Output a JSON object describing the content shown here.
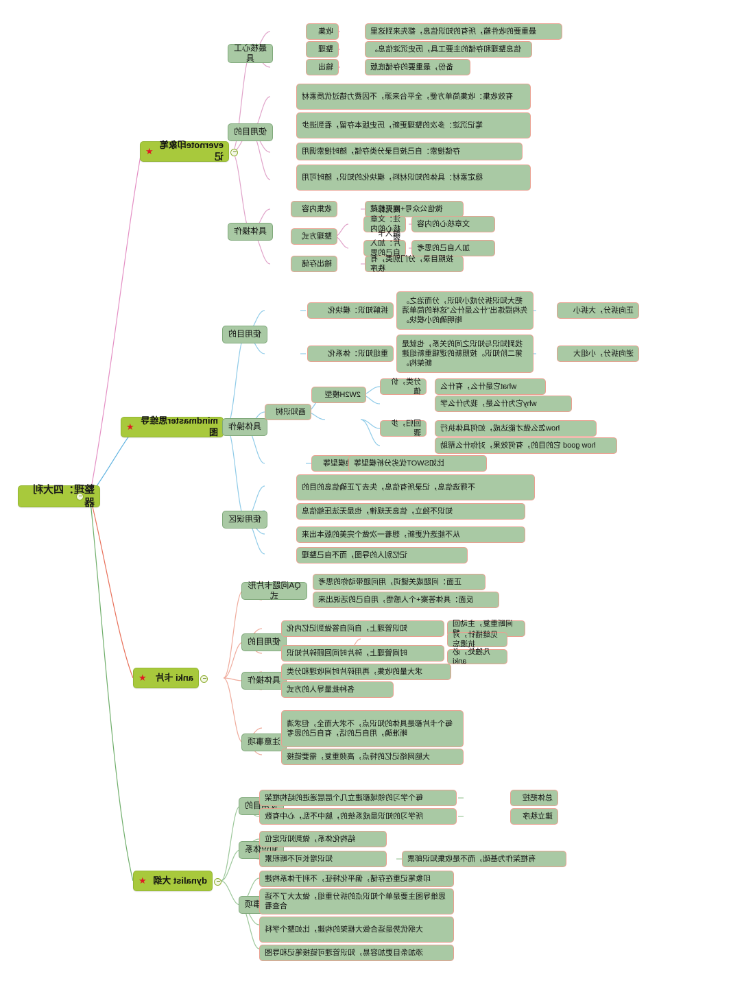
{
  "root": {
    "label": "整理：四大利器"
  },
  "star_glyph": "★",
  "colors": {
    "root_fill": "#a8c93c",
    "branch_fill": "#a8c93c",
    "leaf_fill": "#a9c9a4",
    "leaf_border": "#e9a090",
    "lvl2_border": "#7fa87a",
    "star": "#e01b24",
    "link_evernote": "#e48fc4",
    "link_mindmaster": "#5fb2e0",
    "link_anki": "#e8705a",
    "link_dynalist": "#6fae6a"
  },
  "branches": {
    "evernote": {
      "label": "evernote印象笔记",
      "groups": {
        "core_tool": {
          "label": "最核心工具"
        },
        "purpose": {
          "label": "使用目的"
        },
        "operation": {
          "label": "具体操作"
        }
      },
      "core_tool_items": [
        {
          "label": "收集",
          "desc": "最重要的收件箱，所有的知识信息，都先来到这里"
        },
        {
          "label": "整理",
          "desc": "信息整理和存储的主要工具，历史沉淀信息。"
        },
        {
          "label": "输出",
          "desc": "备份，最重要的存储底版"
        }
      ],
      "purpose_items": [
        "有效收集：收集简单方便，全平台来源，不因费力错过优质素材",
        "笔记沉淀：多次的整理更新，历史版本存留，看到进步",
        "存储搜索：自己按目录分类存储，随时搜索调用",
        "稳定素材：具体的知识材料，模块化的知识，随时可用"
      ],
      "operation_items": [
        {
          "label": "收集内容",
          "desc": "微信公众号+网页剪藏"
        },
        {
          "label": "整理方式",
          "desc": "",
          "children": [
            "高光标注：文章核心的内容",
            "融入卡片：加入自己的思考"
          ]
        },
        {
          "label": "输出存储",
          "desc": "按照目录，分门别类，有秩序"
        }
      ]
    },
    "mindmaster": {
      "label": "mindmaster思维导图",
      "groups": {
        "purpose": {
          "label": "使用目的"
        },
        "operation": {
          "label": "具体操作"
        },
        "pitfalls": {
          "label": "使用误区"
        }
      },
      "purpose_items": [
        {
          "label": "拆解知识：模块化",
          "desc": "把大知识拆分成小知识，分而治之。先构提炼出“什么是什么”这样的简单清晰明确的小模块。",
          "tag": "正向拆分，大拆小"
        },
        {
          "label": "重组知识：体系化",
          "desc": "找到知识与知识之间的关系，也就是第二阶知识。按照新的逻辑重新组建新架构。",
          "tag": "逆向拆分，小组大"
        }
      ],
      "operation_root": "画知识树",
      "model_2w2h": {
        "label": "2W2H模型",
        "groups": [
          {
            "label": "分类，价值",
            "items": [
              "what它是什么，有什么",
              "why它为什么是，我为什么学"
            ]
          },
          {
            "label": "回归，步骤",
            "items": [
              "how怎么做才能达成，如何具体执行",
              "how good 它的目的，有何效果，对你什么帮助"
            ]
          }
        ]
      },
      "other_model": {
        "label": "其他模型等",
        "desc": "比如SWOT优劣分析模型等"
      },
      "pitfall_items": [
        "不筛选信息，记录所有信息，失去了正确信息的目的",
        "知识不独立，信息无规律，也是无法压缩信息",
        "从不能迭代更新，想着一次做个完美的版本出来",
        "记忆别人的导图，而不自己整理"
      ]
    },
    "anki": {
      "label": "anki 卡片",
      "groups": {
        "qa_form": {
          "label": "QA问题卡片形式"
        },
        "purpose": {
          "label": "使用目的"
        },
        "operation": {
          "label": "具体操作"
        },
        "notes": {
          "label": "注意事项"
        }
      },
      "qa_items": [
        "正面：问题或关键词，用问题带动你的思考",
        "反面：具体答案+个人感悟，用自己的活说出来"
      ],
      "purpose_items": [
        {
          "label": "知识管理上，自问自答做到记忆内化",
          "tag": "间断重复，主动回想"
        },
        {
          "label": "时间管理上，碎片时间回顾碎片知识",
          "tags": [
            "见缝插针，对抗遗忘",
            "凡独处，必anki"
          ]
        }
      ],
      "operation_items": [
        "求大量的收集，再用碎片时间收理和分类",
        "各种批量导人的方式"
      ],
      "note_items": [
        "每个卡片都是具体的知识点，不求大而全，但求清晰准确，用自己的话，有自己的思考",
        "大脑网络记忆的特点，高频重复，需要链接"
      ]
    },
    "dynalist": {
      "label": "dynalist 大纲",
      "groups": {
        "purpose": {
          "label": "使用目的"
        },
        "system": {
          "label": "知识体系"
        },
        "notes": {
          "label": "注意事项"
        }
      },
      "purpose_items": [
        {
          "label": "每个学习的领域都建立几个层层递进的结构框架",
          "tag": "总体把控"
        },
        {
          "label": "所学习的知识是成系统的，脑中不乱，心中有数",
          "tag": "建立秩序"
        }
      ],
      "system_items": [
        {
          "label": "结构化体系，做到知识定位"
        },
        {
          "label": "知识增长可不断积累",
          "tag": "有框架作为基础，而不是收集知识邮票"
        }
      ],
      "note_items": [
        "印象笔记重在存储，偏平化特征，不利于体系构建",
        "思维导图主要是单个知识点的拆分重组，做太大了不适合查看",
        "大纲优势是适合做大框架的构建，比如整个学科",
        "添加条目更加容易，知识管理可链接笔记和导图"
      ]
    }
  }
}
